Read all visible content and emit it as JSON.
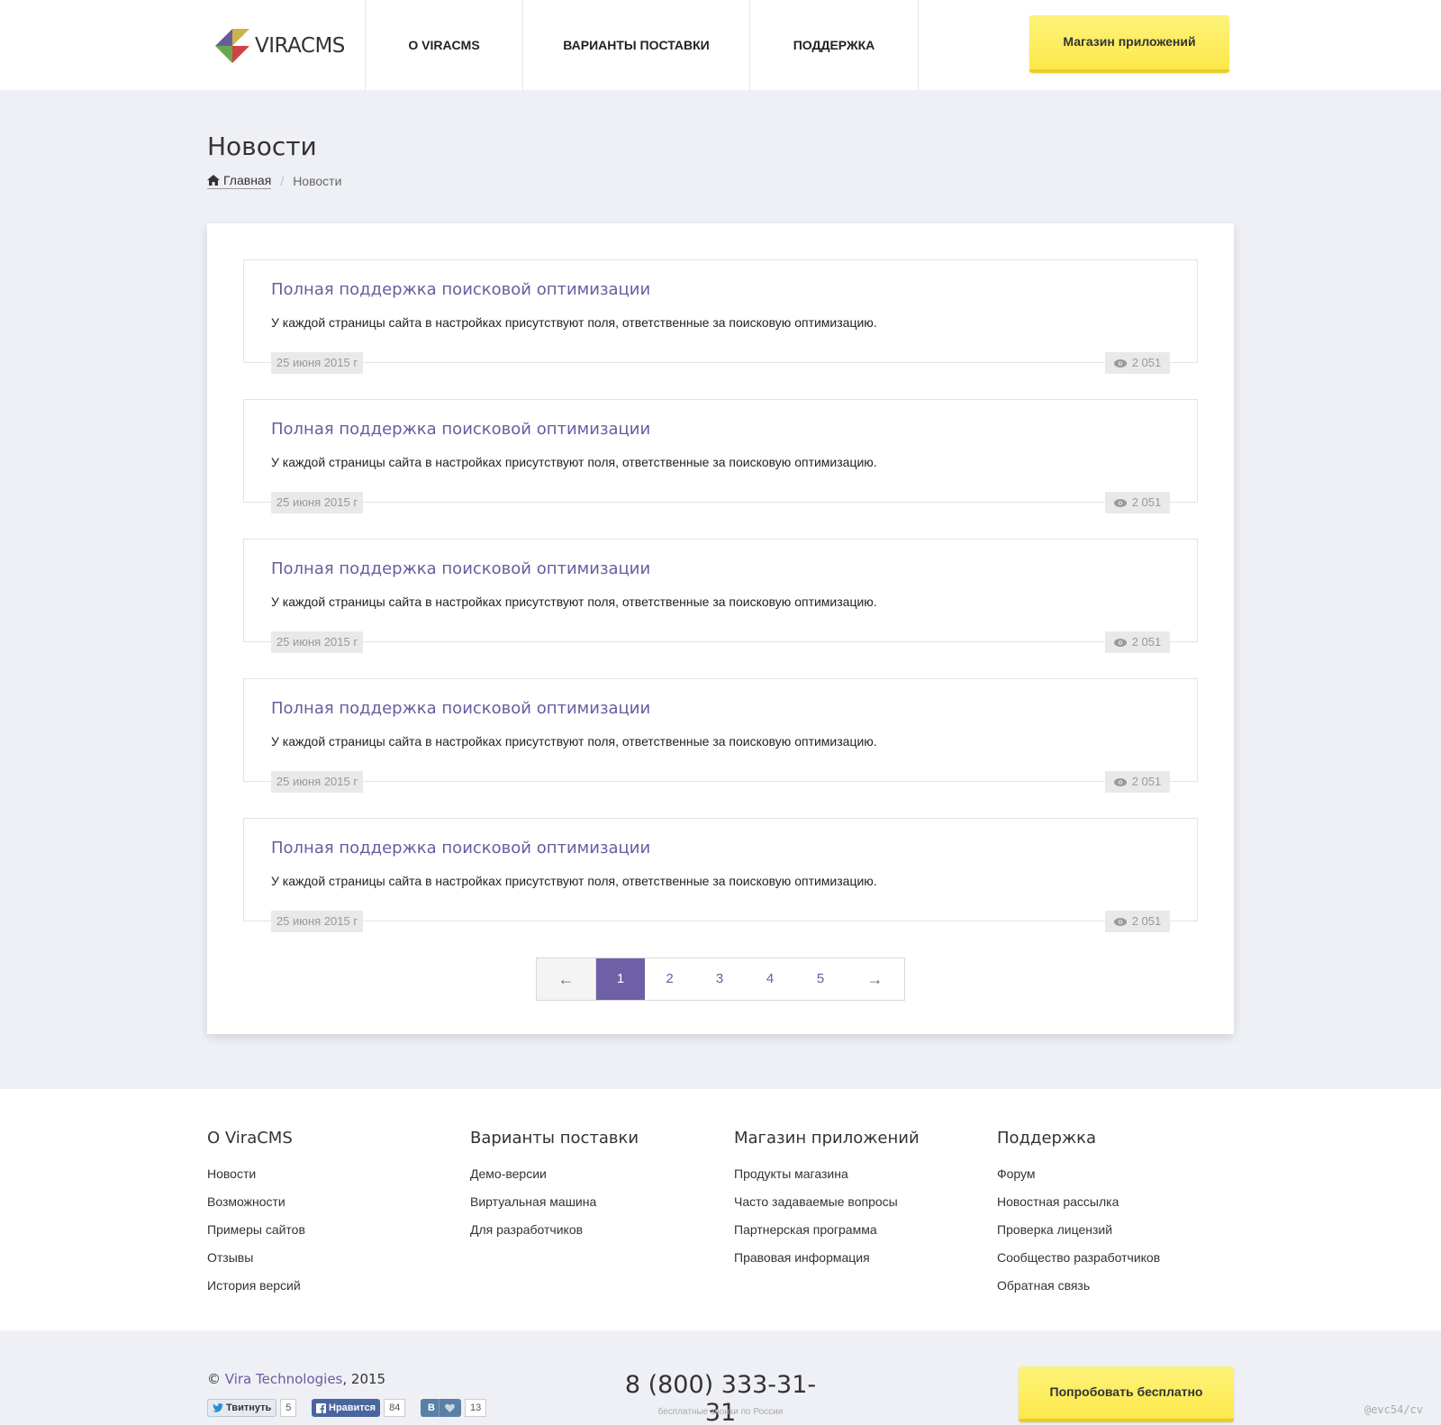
{
  "header": {
    "logo_text": "VIRACMS",
    "nav": [
      "О VIRACMS",
      "ВАРИАНТЫ ПОСТАВКИ",
      "ПОДДЕРЖКА"
    ],
    "store_button": "Магазин приложений"
  },
  "page": {
    "title": "Новости",
    "breadcrumb": {
      "home": "Главная",
      "current": "Новости"
    }
  },
  "news": [
    {
      "title": "Полная поддержка поисковой оптимизации",
      "text": "У каждой страницы сайта в настройках присутствуют поля, ответственные за поисковую оптимизацию.",
      "date": "25 июня 2015 г",
      "views": "2 051"
    },
    {
      "title": "Полная поддержка поисковой оптимизации",
      "text": "У каждой страницы сайта в настройках присутствуют поля, ответственные за поисковую оптимизацию.",
      "date": "25 июня 2015 г",
      "views": "2 051"
    },
    {
      "title": "Полная поддержка поисковой оптимизации",
      "text": "У каждой страницы сайта в настройках присутствуют поля, ответственные за поисковую оптимизацию.",
      "date": "25 июня 2015 г",
      "views": "2 051"
    },
    {
      "title": "Полная поддержка поисковой оптимизации",
      "text": "У каждой страницы сайта в настройках присутствуют поля, ответственные за поисковую оптимизацию.",
      "date": "25 июня 2015 г",
      "views": "2 051"
    },
    {
      "title": "Полная поддержка поисковой оптимизации",
      "text": "У каждой страницы сайта в настройках присутствуют поля, ответственные за поисковую оптимизацию.",
      "date": "25 июня 2015 г",
      "views": "2 051"
    }
  ],
  "pagination": {
    "prev": "←",
    "next": "→",
    "pages": [
      "1",
      "2",
      "3",
      "4",
      "5"
    ],
    "active": "1"
  },
  "footer": {
    "columns": [
      {
        "heading": "О ViraCMS",
        "links": [
          "Новости",
          "Возможности",
          "Примеры сайтов",
          "Отзывы",
          "История версий"
        ]
      },
      {
        "heading": "Варианты поставки",
        "links": [
          "Демо-версии",
          "Виртуальная машина",
          "Для разработчиков"
        ]
      },
      {
        "heading": "Магазин приложений",
        "links": [
          "Продукты магазина",
          "Часто задаваемые вопросы",
          "Партнерская программа",
          "Правовая информация"
        ]
      },
      {
        "heading": "Поддержка",
        "links": [
          "Форум",
          "Новостная рассылка",
          "Проверка лицензий",
          "Сообщество разработчиков",
          "Обратная связь"
        ]
      }
    ],
    "copyright_symbol": "©",
    "company": "Vira Technologies",
    "year": ", 2015",
    "social": {
      "twitter_label": "Твитнуть",
      "twitter_count": "5",
      "facebook_label": "Нравится",
      "facebook_count": "84",
      "vk_label": "В",
      "vk_count": "13"
    },
    "phone": "8 (800) 333-31-31",
    "phone_note": "бесплатные звонки по России",
    "try_button": "Попробовать бесплатно",
    "watermark": "@evc54/cv"
  },
  "colors": {
    "accent": "#6f5fa6",
    "button_yellow": "#fde84a",
    "background": "#eef0f5"
  },
  "icons": [
    "logo-mark-icon",
    "home-icon",
    "eye-icon",
    "twitter-icon",
    "facebook-icon",
    "heart-icon"
  ]
}
